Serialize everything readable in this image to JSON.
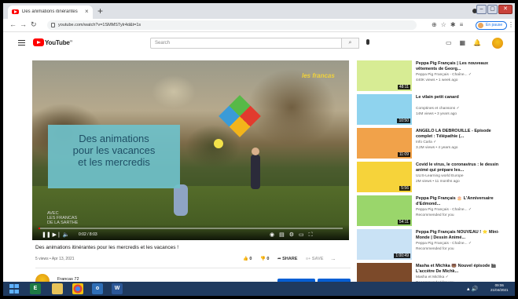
{
  "browser": {
    "tab_title": "Des animations itinérantes p",
    "tab_close": "×",
    "new_tab": "+",
    "url": "youtube.com/watch?v=1SMMSTylr4d&t=1s",
    "paused_label": "En pause",
    "window_controls": [
      "–",
      "▢",
      "✕"
    ]
  },
  "youtube": {
    "logo_text": "YouTube",
    "logo_sup": "FR",
    "search_placeholder": "Search"
  },
  "player": {
    "overlay_lines": [
      "Des animations",
      "pour les vacances",
      "et les mercredis"
    ],
    "corner_logo": "les francas",
    "watermark_lines": [
      "AVEC",
      "LES FRANCAS",
      "DE LA SARTHE"
    ],
    "time": "0:02 / 8:03",
    "progress": 0.004
  },
  "video": {
    "title": "Des animations itinérantes pour les mercredis et les vacances !",
    "meta": "5 views • Apr 13, 2021",
    "likes": "0",
    "dislikes": "0",
    "share": "SHARE",
    "save": "SAVE",
    "more": "...",
    "channel": "Francas 72",
    "analytics": "ANALYTICS",
    "edit_video": "EDIT VIDEO"
  },
  "sidebar": [
    {
      "title": "Peppa Pig Français | Les nouveaux vêtements de Georg...",
      "channel": "Peppa Pig Français - Chaîne... ✓",
      "views": "440K views • 1 week ago",
      "duration": "48:11",
      "color": "#d7ec94"
    },
    {
      "title": "Le vilain petit canard",
      "channel": "Comptines et chansons ✓",
      "views": "14M views • 3 years ago",
      "duration": "10:50",
      "color": "#8fd3ee"
    },
    {
      "title": "ANGELO LA DEBROUILLE - Épisode complet : Télépathie (...",
      "channel": "Info Carla ✓",
      "views": "3.2M views • 4 years ago",
      "duration": "11:09",
      "color": "#f1a24a"
    },
    {
      "title": "Covid le virus, le coronavirus : le dessin animé qui prépare les...",
      "channel": "ULIS-Learning world Europe",
      "views": "2M views • 11 months ago",
      "duration": "5:56",
      "color": "#f6d33a"
    },
    {
      "title": "Peppa Pig Français 🎂 L'Anniversaire d'Edmond...",
      "channel": "Peppa Pig Français - Chaîne... ✓",
      "views": "Recommended for you",
      "duration": "54:11",
      "color": "#9ad66b"
    },
    {
      "title": "Peppa Pig Français NOUVEAU ! ⭐ Mini-Monde | Dessin Animé...",
      "channel": "Peppa Pig Français - Chaîne... ✓",
      "views": "Recommended for you",
      "duration": "1:00:49",
      "color": "#c9e2f5"
    },
    {
      "title": "Masha et Michka 🐻 Nouvel épisode 🎬 L'accètre De Michk...",
      "channel": "Masha et Michka ✓",
      "views": "Recommended for you",
      "duration": "",
      "color": "#7c4a2a"
    }
  ],
  "taskbar": {
    "apps": [
      "E",
      "W"
    ],
    "time": "09:06",
    "date": "21/04/2021"
  }
}
